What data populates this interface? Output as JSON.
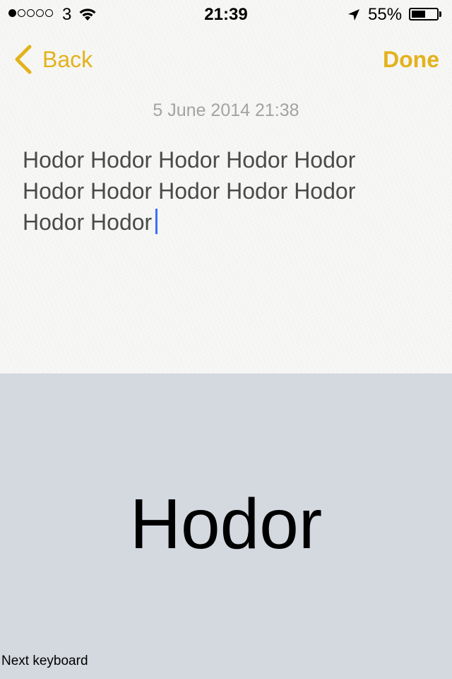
{
  "status_bar": {
    "carrier": "3",
    "time": "21:39",
    "battery_percent": "55%",
    "battery_level": 0.55,
    "signal_bars_filled": 1,
    "signal_bars_total": 5
  },
  "nav": {
    "back_label": "Back",
    "done_label": "Done"
  },
  "note": {
    "date": "5 June 2014 21:38",
    "lines": [
      "Hodor Hodor Hodor Hodor Hodor",
      "Hodor Hodor Hodor Hodor Hodor",
      "Hodor Hodor"
    ]
  },
  "keyboard": {
    "key_label": "Hodor",
    "next_keyboard_label": "Next keyboard"
  },
  "colors": {
    "accent": "#e3b21c",
    "caret": "#3b70ff",
    "keyboard_bg": "#d4d8df"
  },
  "icons": [
    "back-chevron-icon",
    "wifi-icon",
    "location-arrow-icon",
    "battery-icon",
    "signal-dots-icon"
  ]
}
